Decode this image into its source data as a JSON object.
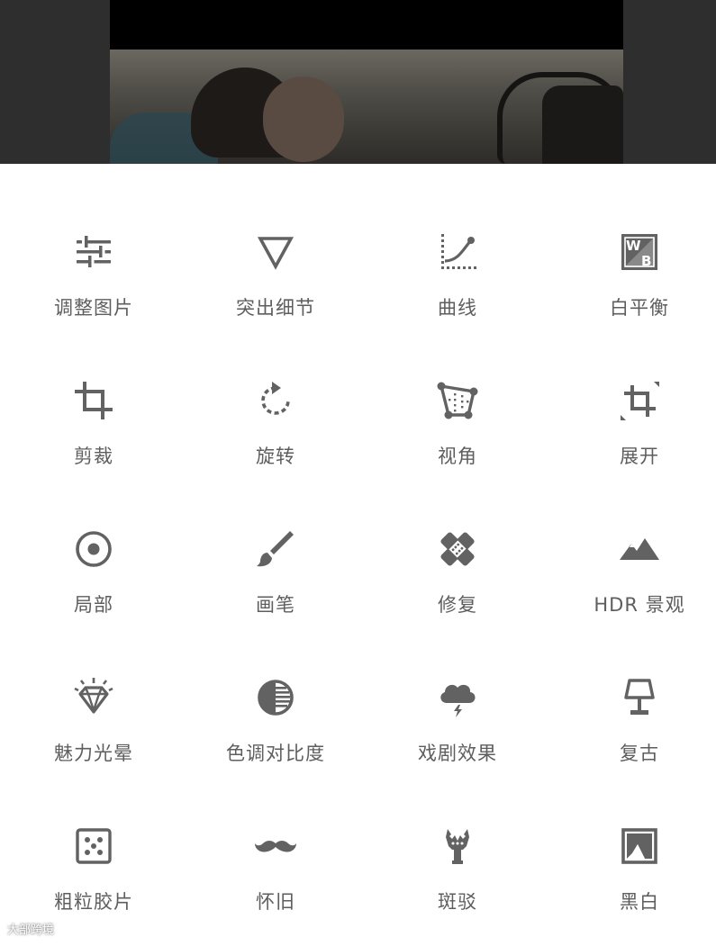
{
  "tools": [
    {
      "label": "调整图片",
      "icon": "tune-sliders-icon"
    },
    {
      "label": "突出细节",
      "icon": "details-triangle-icon"
    },
    {
      "label": "曲线",
      "icon": "curves-icon"
    },
    {
      "label": "白平衡",
      "icon": "white-balance-icon"
    },
    {
      "label": "剪裁",
      "icon": "crop-icon"
    },
    {
      "label": "旋转",
      "icon": "rotate-icon"
    },
    {
      "label": "视角",
      "icon": "perspective-icon"
    },
    {
      "label": "展开",
      "icon": "expand-icon"
    },
    {
      "label": "局部",
      "icon": "selective-target-icon"
    },
    {
      "label": "画笔",
      "icon": "brush-icon"
    },
    {
      "label": "修复",
      "icon": "healing-bandage-icon"
    },
    {
      "label": "HDR 景观",
      "icon": "mountains-icon"
    },
    {
      "label": "魅力光晕",
      "icon": "diamond-glow-icon"
    },
    {
      "label": "色调对比度",
      "icon": "tonal-contrast-icon"
    },
    {
      "label": "戏剧效果",
      "icon": "drama-cloud-icon"
    },
    {
      "label": "复古",
      "icon": "vintage-lamp-icon"
    },
    {
      "label": "粗粒胶片",
      "icon": "grainy-film-icon"
    },
    {
      "label": "怀旧",
      "icon": "mustache-icon"
    },
    {
      "label": "斑驳",
      "icon": "grunge-guitar-icon"
    },
    {
      "label": "黑白",
      "icon": "black-white-icon"
    }
  ],
  "watermark": "大部跨境",
  "colors": {
    "icon": "#626262",
    "label": "#5e5e5e",
    "preview_bg": "#2e2e2e"
  }
}
